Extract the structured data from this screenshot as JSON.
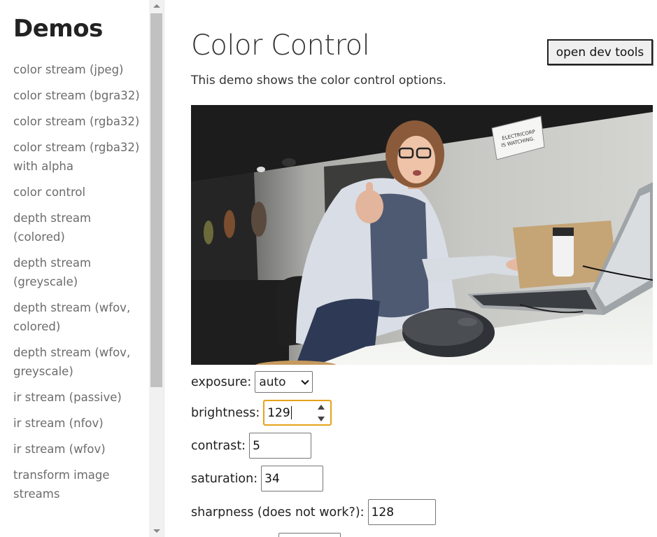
{
  "sidebar": {
    "title": "Demos",
    "items": [
      {
        "label": "color stream (jpeg)"
      },
      {
        "label": "color stream (bgra32)"
      },
      {
        "label": "color stream (rgba32)"
      },
      {
        "label": "color stream (rgba32) with alpha"
      },
      {
        "label": "color control"
      },
      {
        "label": "depth stream (colored)"
      },
      {
        "label": "depth stream (greyscale)"
      },
      {
        "label": "depth stream (wfov, colored)"
      },
      {
        "label": "depth stream (wfov, greyscale)"
      },
      {
        "label": "ir stream (passive)"
      },
      {
        "label": "ir stream (nfov)"
      },
      {
        "label": "ir stream (wfov)"
      },
      {
        "label": "transform image streams"
      }
    ]
  },
  "main": {
    "title": "Color Control",
    "devtools_label": "open dev tools",
    "description": "This demo shows the color control options.",
    "image": {
      "sign_line1": "ELECTRICORP",
      "sign_line2": "IS WATCHING."
    },
    "controls": {
      "exposure": {
        "label": "exposure:",
        "value": "auto"
      },
      "brightness": {
        "label": "brightness:",
        "value": "129"
      },
      "contrast": {
        "label": "contrast:",
        "value": "5"
      },
      "saturation": {
        "label": "saturation:",
        "value": "34"
      },
      "sharpness": {
        "label": "sharpness (does not work?):",
        "value": "128"
      }
    }
  },
  "colors": {
    "focus_ring": "#e6a21a",
    "nav_text": "#6c6c6c"
  }
}
